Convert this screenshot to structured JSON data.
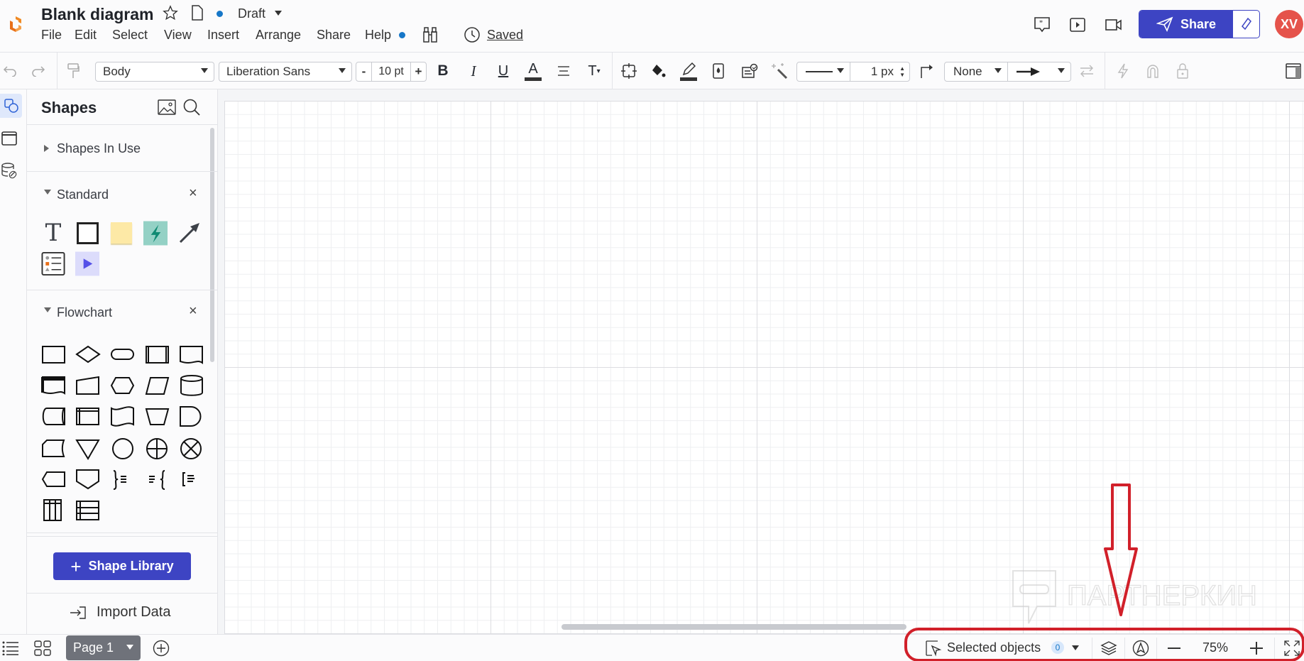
{
  "header": {
    "title": "Blank diagram",
    "status": "Draft",
    "menu": [
      "File",
      "Edit",
      "Select",
      "View",
      "Insert",
      "Arrange",
      "Share",
      "Help"
    ],
    "saved_label": "Saved",
    "share_label": "Share",
    "avatar_initials": "XV",
    "brand_color": "#3d44c3",
    "avatar_color": "#e5534b"
  },
  "toolbar": {
    "text_style": "Body",
    "font": "Liberation Sans",
    "font_size": "10 pt",
    "decrease": "-",
    "increase": "+",
    "line_width": "1 px",
    "line_start": "None"
  },
  "sidebar": {
    "title": "Shapes",
    "sections": [
      {
        "label": "Shapes In Use"
      },
      {
        "label": "Standard"
      },
      {
        "label": "Flowchart"
      }
    ],
    "shape_library_label": "Shape Library",
    "import_label": "Import Data"
  },
  "bottom": {
    "page_label": "Page 1",
    "selected_label": "Selected objects",
    "selected_count": "0",
    "zoom": "75%"
  },
  "watermark": "ПАРТНЕРКИН"
}
